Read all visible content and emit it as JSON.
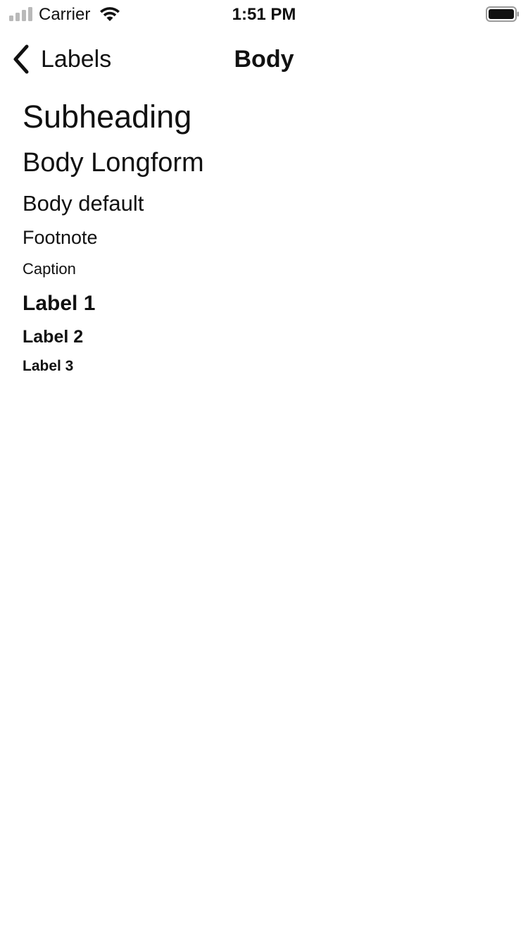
{
  "status_bar": {
    "carrier": "Carrier",
    "time": "1:51 PM",
    "signal_icon": "cellular-signal-icon",
    "wifi_icon": "wifi-icon",
    "battery_icon": "battery-icon"
  },
  "nav": {
    "back_label": "Labels",
    "back_icon": "chevron-left-icon",
    "title": "Body"
  },
  "styles": [
    {
      "key": "subheading",
      "text": "Subheading"
    },
    {
      "key": "longform",
      "text": "Body Longform"
    },
    {
      "key": "body",
      "text": "Body default"
    },
    {
      "key": "footnote",
      "text": "Footnote"
    },
    {
      "key": "caption",
      "text": "Caption"
    },
    {
      "key": "label1",
      "text": "Label 1"
    },
    {
      "key": "label2",
      "text": "Label 2"
    },
    {
      "key": "label3",
      "text": "Label 3"
    }
  ],
  "colors": {
    "text": "#111111",
    "background": "#ffffff",
    "signal_inactive": "#b9b9b9"
  }
}
